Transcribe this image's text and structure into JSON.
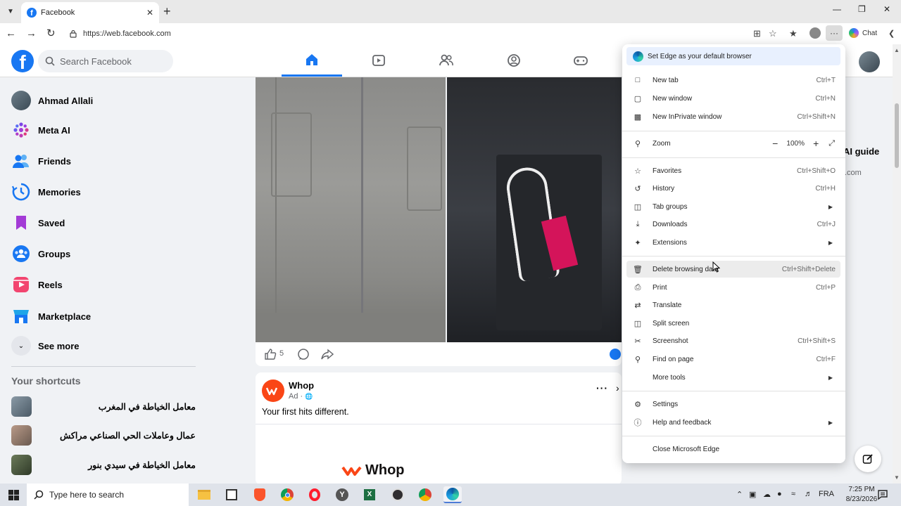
{
  "browser": {
    "tab_title": "Facebook",
    "url": "https://web.facebook.com",
    "chat_label": "Chat"
  },
  "facebook": {
    "search_placeholder": "Search Facebook",
    "left_nav": [
      {
        "label": "Ahmad Allali",
        "icon": "user-avatar"
      },
      {
        "label": "Meta AI",
        "icon": "meta-ai-icon"
      },
      {
        "label": "Friends",
        "icon": "friends-icon"
      },
      {
        "label": "Memories",
        "icon": "memories-icon"
      },
      {
        "label": "Saved",
        "icon": "saved-icon"
      },
      {
        "label": "Groups",
        "icon": "groups-icon"
      },
      {
        "label": "Reels",
        "icon": "reels-icon"
      },
      {
        "label": "Marketplace",
        "icon": "marketplace-icon"
      },
      {
        "label": "See more",
        "icon": "chevron-down-icon"
      }
    ],
    "shortcuts_title": "Your shortcuts",
    "shortcuts": [
      "معامل الخياطة في المغرب",
      "عمال وعاملات الحي الصناعي مراكش",
      "معامل الخياطة في سيدي بنور"
    ],
    "post": {
      "like_count": "5"
    },
    "ad": {
      "advertiser": "Whop",
      "meta": "Ad ·",
      "text": "Your first hits different.",
      "brand_text": "Whop"
    },
    "right_column": {
      "guide_text": "AI guide",
      "domain_text": ".com"
    }
  },
  "edge_menu": {
    "banner": "Set Edge as your default browser",
    "items": [
      {
        "label": "New tab",
        "shortcut": "Ctrl+T",
        "icon": "new-tab-icon"
      },
      {
        "label": "New window",
        "shortcut": "Ctrl+N",
        "icon": "new-window-icon"
      },
      {
        "label": "New InPrivate window",
        "shortcut": "Ctrl+Shift+N",
        "icon": "inprivate-icon"
      },
      {
        "label": "Zoom",
        "shortcut": "",
        "icon": "zoom-icon"
      },
      {
        "label": "Favorites",
        "shortcut": "Ctrl+Shift+O",
        "icon": "favorites-icon"
      },
      {
        "label": "History",
        "shortcut": "Ctrl+H",
        "icon": "history-icon"
      },
      {
        "label": "Tab groups",
        "shortcut": "",
        "icon": "tab-groups-icon"
      },
      {
        "label": "Downloads",
        "shortcut": "Ctrl+J",
        "icon": "downloads-icon"
      },
      {
        "label": "Extensions",
        "shortcut": "",
        "icon": "extensions-icon"
      },
      {
        "label": "Delete browsing data",
        "shortcut": "Ctrl+Shift+Delete",
        "icon": "trash-icon"
      },
      {
        "label": "Print",
        "shortcut": "Ctrl+P",
        "icon": "print-icon"
      },
      {
        "label": "Translate",
        "shortcut": "",
        "icon": "translate-icon"
      },
      {
        "label": "Split screen",
        "shortcut": "",
        "icon": "split-screen-icon"
      },
      {
        "label": "Screenshot",
        "shortcut": "Ctrl+Shift+S",
        "icon": "screenshot-icon"
      },
      {
        "label": "Find on page",
        "shortcut": "Ctrl+F",
        "icon": "find-icon"
      },
      {
        "label": "More tools",
        "shortcut": "",
        "icon": ""
      },
      {
        "label": "Settings",
        "shortcut": "",
        "icon": "settings-icon"
      },
      {
        "label": "Help and feedback",
        "shortcut": "",
        "icon": "help-icon"
      },
      {
        "label": "Close Microsoft Edge",
        "shortcut": "",
        "icon": ""
      }
    ],
    "zoom_value": "100%"
  },
  "taskbar": {
    "search_placeholder": "Type here to search",
    "language": "FRA",
    "time": "7:25 PM",
    "date": "8/23/2026"
  },
  "colors": {
    "facebook_blue": "#1877f2",
    "whop_orange": "#fa4616",
    "menu_hover": "#ececec"
  }
}
